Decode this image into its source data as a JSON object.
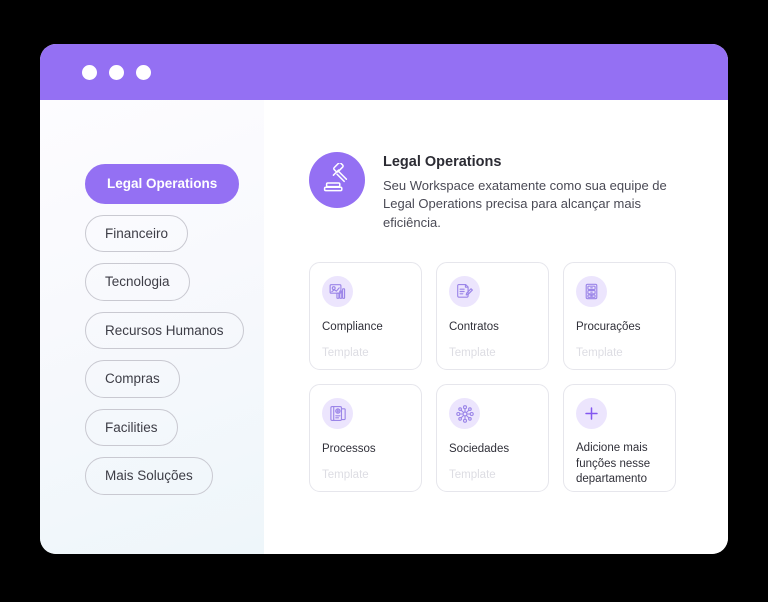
{
  "window": {
    "titlebar_dots": [
      "dot-1",
      "dot-2",
      "dot-3"
    ],
    "accent_color": "#9470F3",
    "icon_bg_color": "#ECE5FD",
    "card_border_color": "#E6E6EC",
    "muted_text_color": "#DDDDE3"
  },
  "sidebar": {
    "items": [
      {
        "label": "Legal Operations",
        "active": true
      },
      {
        "label": "Financeiro",
        "active": false
      },
      {
        "label": "Tecnologia",
        "active": false
      },
      {
        "label": "Recursos Humanos",
        "active": false
      },
      {
        "label": "Compras",
        "active": false
      },
      {
        "label": "Facilities",
        "active": false
      },
      {
        "label": "Mais Soluções",
        "active": false
      }
    ]
  },
  "department": {
    "icon": "gavel-icon",
    "title": "Legal Operations",
    "description": "Seu Workspace exatamente como sua equipe de Legal Operations precisa para alcançar mais eficiência."
  },
  "cards": [
    {
      "icon": "compliance-chart-icon",
      "title": "Compliance",
      "subtitle": "Template"
    },
    {
      "icon": "contract-document-pencil-icon",
      "title": "Contratos",
      "subtitle": "Template"
    },
    {
      "icon": "filing-cabinet-icon",
      "title": "Procurações",
      "subtitle": "Template"
    },
    {
      "icon": "legal-case-icon",
      "title": "Processos",
      "subtitle": "Template"
    },
    {
      "icon": "network-nodes-icon",
      "title": "Sociedades",
      "subtitle": "Template"
    },
    {
      "icon": "plus-icon",
      "title": "Adicione mais funções nesse departamento",
      "subtitle": ""
    }
  ]
}
